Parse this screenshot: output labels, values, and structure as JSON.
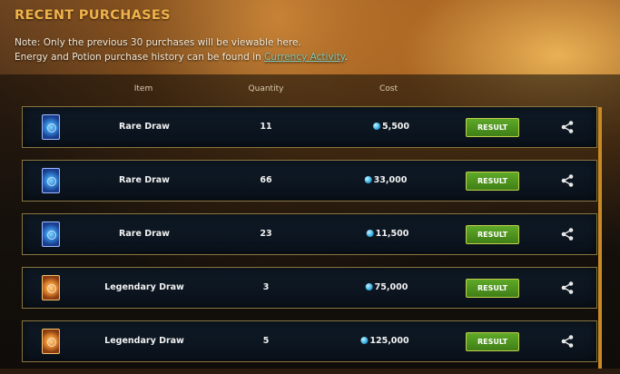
{
  "header": {
    "title": "RECENT PURCHASES",
    "note_line1": "Note: Only the previous 30 purchases will be viewable here.",
    "note_line2_prefix": "Energy and Potion purchase history can be found in ",
    "note_link": "Currency Activity",
    "note_line2_suffix": "."
  },
  "columns": {
    "item": "Item",
    "quantity": "Quantity",
    "cost": "Cost"
  },
  "rows": [
    {
      "icon": "rare-draw-card-icon",
      "item": "Rare Draw",
      "quantity": "11",
      "cost": "5,500",
      "result": "RESULT"
    },
    {
      "icon": "rare-draw-card-icon",
      "item": "Rare Draw",
      "quantity": "66",
      "cost": "33,000",
      "result": "RESULT"
    },
    {
      "icon": "rare-draw-card-icon",
      "item": "Rare Draw",
      "quantity": "23",
      "cost": "11,500",
      "result": "RESULT"
    },
    {
      "icon": "legendary-draw-card-icon",
      "item": "Legendary Draw",
      "quantity": "3",
      "cost": "75,000",
      "result": "RESULT"
    },
    {
      "icon": "legendary-draw-card-icon",
      "item": "Legendary Draw",
      "quantity": "5",
      "cost": "125,000",
      "result": "RESULT"
    }
  ],
  "colors": {
    "title": "#f0b24a",
    "link": "#7fc9b7",
    "result_button": "#4f9420",
    "row_border": "#8a7640",
    "scrollbar": "#c98a23"
  }
}
